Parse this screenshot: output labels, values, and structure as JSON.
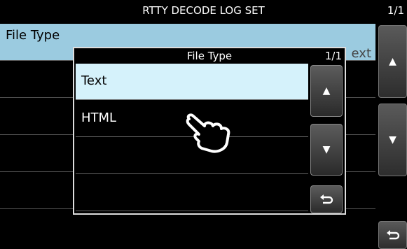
{
  "titlebar": {
    "title": "RTTY DECODE LOG SET",
    "page": "1/1"
  },
  "main": {
    "rows": [
      {
        "label": "File Type",
        "value": "ext"
      },
      {
        "label": ""
      },
      {
        "label": ""
      },
      {
        "label": ""
      },
      {
        "label": ""
      }
    ]
  },
  "side_buttons": {
    "up_icon": "up-triangle-icon",
    "down_icon": "down-triangle-icon",
    "back_icon": "return-icon"
  },
  "dialog": {
    "title": "File Type",
    "page": "1/1",
    "items": [
      {
        "label": "Text",
        "selected": true
      },
      {
        "label": "HTML",
        "selected": false
      },
      {
        "label": ""
      },
      {
        "label": ""
      }
    ]
  },
  "colors": {
    "selected_row": "#9bcbe0",
    "dialog_selected": "#d5f2fb"
  }
}
